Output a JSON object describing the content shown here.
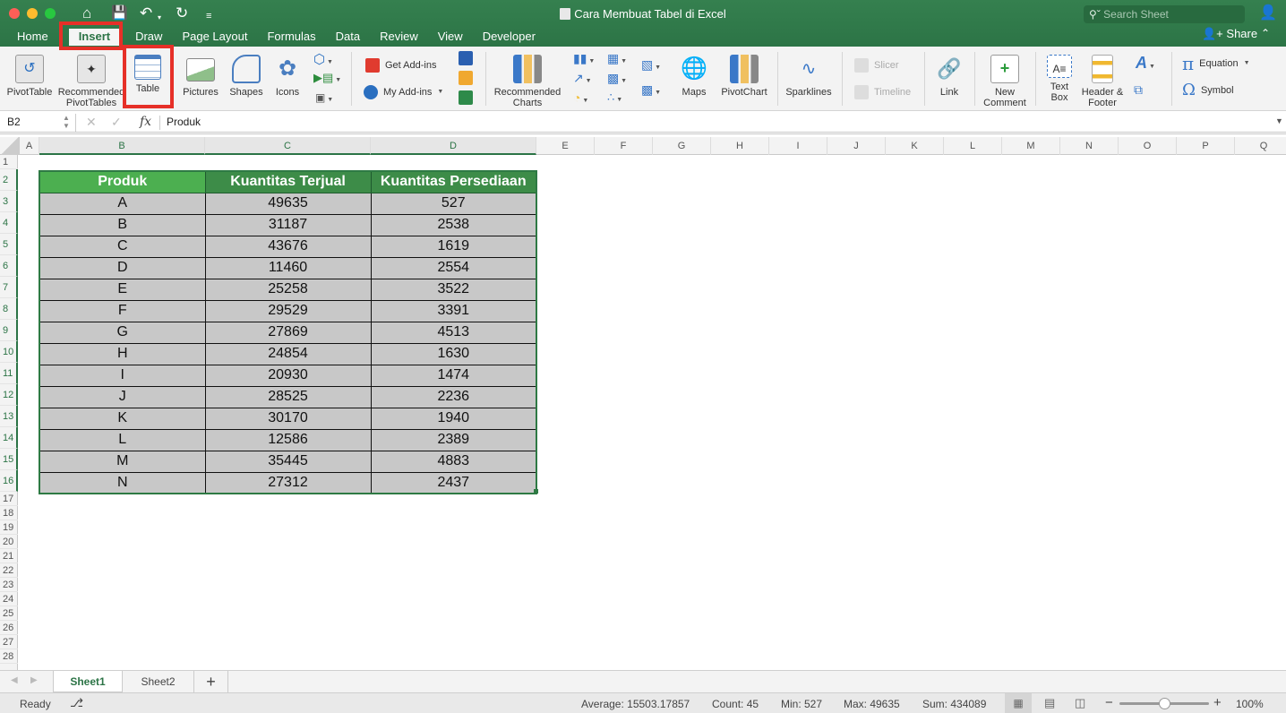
{
  "window": {
    "title": "Cara Membuat Tabel di Excel",
    "search_placeholder": "Search Sheet",
    "share_label": "Share",
    "icons": [
      "home-icon",
      "save-icon",
      "undo-icon",
      "redo-icon",
      "customize-icon"
    ]
  },
  "menu_tabs": [
    {
      "label": "Home"
    },
    {
      "label": "Insert",
      "active": true
    },
    {
      "label": "Draw"
    },
    {
      "label": "Page Layout"
    },
    {
      "label": "Formulas"
    },
    {
      "label": "Data"
    },
    {
      "label": "Review"
    },
    {
      "label": "View"
    },
    {
      "label": "Developer"
    }
  ],
  "ribbon": {
    "pivot_table": "PivotTable",
    "recommended_pivot_1": "Recommended",
    "recommended_pivot_2": "PivotTables",
    "table": "Table",
    "pictures": "Pictures",
    "shapes": "Shapes",
    "icons": "Icons",
    "get_addins": "Get Add-ins",
    "my_addins": "My Add-ins",
    "recommended_charts_1": "Recommended",
    "recommended_charts_2": "Charts",
    "maps": "Maps",
    "pivot_chart": "PivotChart",
    "sparklines": "Sparklines",
    "slicer": "Slicer",
    "timeline": "Timeline",
    "link": "Link",
    "new_comment_1": "New",
    "new_comment_2": "Comment",
    "text_box_1": "Text",
    "text_box_2": "Box",
    "header_footer_1": "Header &",
    "header_footer_2": "Footer",
    "equation": "Equation",
    "symbol": "Symbol"
  },
  "formula_bar": {
    "name_box": "B2",
    "fx": "fx",
    "content": "Produk"
  },
  "columns": [
    "A",
    "B",
    "C",
    "D",
    "E",
    "F",
    "G",
    "H",
    "I",
    "J",
    "K",
    "L",
    "M",
    "N",
    "O",
    "P",
    "Q"
  ],
  "rows": [
    "1",
    "2",
    "3",
    "4",
    "5",
    "6",
    "7",
    "8",
    "9",
    "10",
    "11",
    "12",
    "13",
    "14",
    "15",
    "16",
    "17",
    "18",
    "19",
    "20",
    "21",
    "22",
    "23",
    "24",
    "25",
    "26",
    "27",
    "28"
  ],
  "table": {
    "headers": [
      "Produk",
      "Kuantitas Terjual",
      "Kuantitas Persediaan"
    ],
    "rows": [
      [
        "A",
        "49635",
        "527"
      ],
      [
        "B",
        "31187",
        "2538"
      ],
      [
        "C",
        "43676",
        "1619"
      ],
      [
        "D",
        "11460",
        "2554"
      ],
      [
        "E",
        "25258",
        "3522"
      ],
      [
        "F",
        "29529",
        "3391"
      ],
      [
        "G",
        "27869",
        "4513"
      ],
      [
        "H",
        "24854",
        "1630"
      ],
      [
        "I",
        "20930",
        "1474"
      ],
      [
        "J",
        "28525",
        "2236"
      ],
      [
        "K",
        "30170",
        "1940"
      ],
      [
        "L",
        "12586",
        "2389"
      ],
      [
        "M",
        "35445",
        "4883"
      ],
      [
        "N",
        "27312",
        "2437"
      ]
    ]
  },
  "sheets": [
    {
      "label": "Sheet1",
      "active": true
    },
    {
      "label": "Sheet2"
    }
  ],
  "add_sheet": "+",
  "status": {
    "ready": "Ready",
    "average": "Average: 15503.17857",
    "count": "Count: 45",
    "min": "Min: 527",
    "max": "Max: 49635",
    "sum": "Sum: 434089",
    "zoom": "100%",
    "zoom_fraction": 0.5
  },
  "colors": {
    "accent": "#2c7446",
    "highlight": "#e63028",
    "header_green": "#3d8c48",
    "header_first": "#4caf50",
    "cell_gray": "#c8c8c8"
  }
}
